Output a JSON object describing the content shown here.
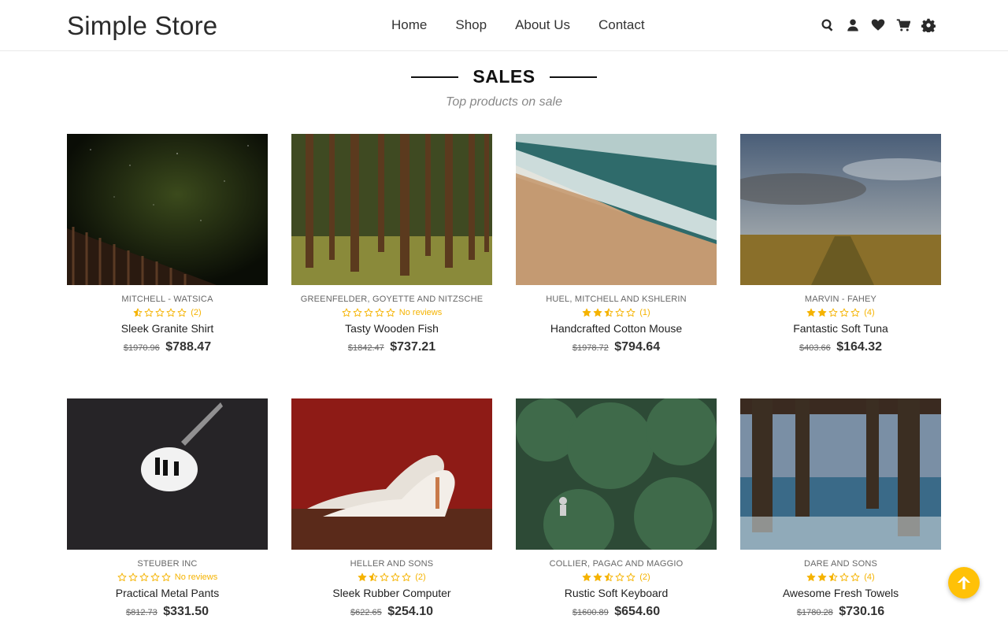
{
  "header": {
    "logo": "Simple Store",
    "nav": [
      "Home",
      "Shop",
      "About Us",
      "Contact"
    ],
    "icons": [
      "search-icon",
      "user-icon",
      "heart-icon",
      "cart-icon",
      "gear-icon"
    ]
  },
  "section": {
    "title": "SALES",
    "subtitle": "Top products on sale"
  },
  "colors": {
    "star": "#f5b301",
    "back_to_top": "#ffc107"
  },
  "products": [
    {
      "brand": "MITCHELL - WATSICA",
      "stars": 0.5,
      "rating_text": "(2)",
      "name": "Sleek Granite Shirt",
      "old_price": "$1970.96",
      "price": "$788.47",
      "image": "night-sky-fence"
    },
    {
      "brand": "GREENFELDER, GOYETTE AND NITZSCHE",
      "stars": 0,
      "rating_text": "No reviews",
      "name": "Tasty Wooden Fish",
      "old_price": "$1842.47",
      "price": "$737.21",
      "image": "pine-forest"
    },
    {
      "brand": "HUEL, MITCHELL AND KSHLERIN",
      "stars": 2.5,
      "rating_text": "(1)",
      "name": "Handcrafted Cotton Mouse",
      "old_price": "$1978.72",
      "price": "$794.64",
      "image": "beach-waves"
    },
    {
      "brand": "MARVIN - FAHEY",
      "stars": 2,
      "rating_text": "(4)",
      "name": "Fantastic Soft Tuna",
      "old_price": "$403.66",
      "price": "$164.32",
      "image": "grass-field-sky"
    },
    {
      "brand": "STEUBER INC",
      "stars": 0,
      "rating_text": "No reviews",
      "name": "Practical Metal Pants",
      "old_price": "$812.73",
      "price": "$331.50",
      "image": "cave-silhouettes"
    },
    {
      "brand": "HELLER AND SONS",
      "stars": 1.5,
      "rating_text": "(2)",
      "name": "Sleek Rubber Computer",
      "old_price": "$622.65",
      "price": "$254.10",
      "image": "white-heels"
    },
    {
      "brand": "COLLIER, PAGAC AND MAGGIO",
      "stars": 2.5,
      "rating_text": "(2)",
      "name": "Rustic Soft Keyboard",
      "old_price": "$1600.89",
      "price": "$654.60",
      "image": "green-trees-biker"
    },
    {
      "brand": "DARE AND SONS",
      "stars": 2.5,
      "rating_text": "(4)",
      "name": "Awesome Fresh Towels",
      "old_price": "$1780.28",
      "price": "$730.16",
      "image": "pier-pillars"
    }
  ]
}
